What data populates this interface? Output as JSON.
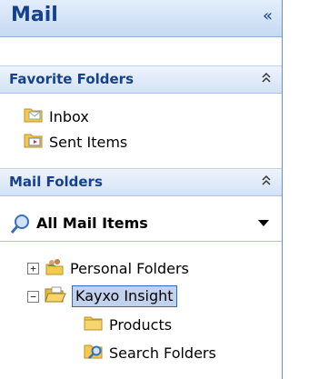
{
  "pane": {
    "title": "Mail",
    "collapse_glyph": "«"
  },
  "favorites": {
    "title": "Favorite Folders",
    "toggle_glyph": "⌃",
    "items": [
      {
        "label": "Inbox",
        "icon": "inbox-folder-icon"
      },
      {
        "label": "Sent Items",
        "icon": "sent-items-folder-icon"
      }
    ]
  },
  "mail_folders": {
    "title": "Mail Folders",
    "toggle_glyph": "⌃",
    "view_selector": {
      "label": "All Mail Items",
      "icon": "search-icon"
    },
    "tree": [
      {
        "label": "Personal Folders",
        "expander": "+",
        "icon": "personal-folders-icon"
      },
      {
        "label": "Kayxo Insight",
        "expander": "−",
        "icon": "open-folder-icon",
        "selected": true
      },
      {
        "label": "Products",
        "icon": "folder-icon"
      },
      {
        "label": "Search Folders",
        "icon": "search-folder-icon"
      }
    ]
  },
  "colors": {
    "title_text": "#15428b",
    "header_bg_top": "#e3eefc",
    "header_bg_bottom": "#c5d9f3",
    "selection_bg": "#c1d2ee",
    "folder_yellow": "#f5c94a"
  }
}
